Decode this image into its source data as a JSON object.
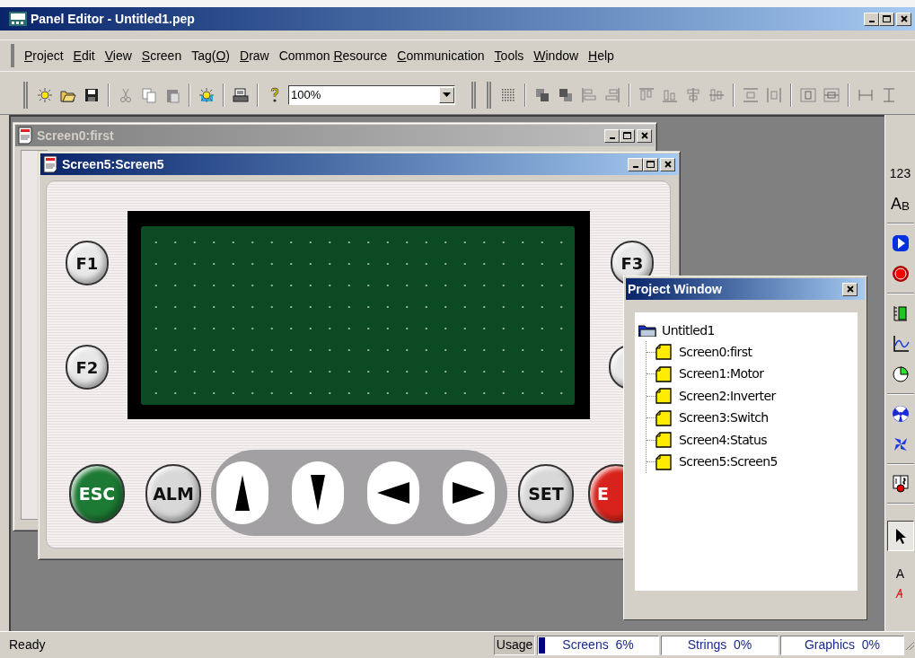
{
  "window": {
    "title": "Panel Editor - Untitled1.pep"
  },
  "menu": [
    {
      "key": "P",
      "post": "roject"
    },
    {
      "key": "E",
      "post": "dit"
    },
    {
      "key": "V",
      "post": "iew"
    },
    {
      "key": "S",
      "post": "creen"
    },
    {
      "pre": "Tag(",
      "key": "O",
      "post": ")"
    },
    {
      "key": "D",
      "post": "raw"
    },
    {
      "pre": "Common ",
      "key": "R",
      "post": "esource"
    },
    {
      "key": "C",
      "post": "ommunication"
    },
    {
      "key": "T",
      "post": "ools"
    },
    {
      "key": "W",
      "post": "indow"
    },
    {
      "key": "H",
      "post": "elp"
    }
  ],
  "toolbar": {
    "zoom": "100%"
  },
  "documents": [
    {
      "title": "Screen0:first",
      "active": false
    },
    {
      "title": "Screen5:Screen5",
      "active": true
    }
  ],
  "panel": {
    "side_keys": [
      {
        "label": "F1"
      },
      {
        "label": "F2"
      },
      {
        "label": "F3"
      }
    ],
    "bottom_keys": [
      {
        "label": "ESC",
        "color": "#1d7a34"
      },
      {
        "label": "ALM",
        "color": "#d8d8d8"
      },
      {
        "label": "SET",
        "color": "#d8d8d8"
      },
      {
        "label": "E",
        "color": "#d8231c"
      }
    ]
  },
  "project_window": {
    "title": "Project Window",
    "tree": {
      "label": "Untitled1",
      "children": [
        {
          "label": "Screen0:first"
        },
        {
          "label": "Screen1:Motor"
        },
        {
          "label": "Screen2:Inverter"
        },
        {
          "label": "Screen3:Switch"
        },
        {
          "label": "Screen4:Status"
        },
        {
          "label": "Screen5:Screen5"
        }
      ]
    }
  },
  "tools": [
    {
      "kind": "text",
      "label": "123",
      "selected": false
    },
    {
      "kind": "text",
      "label": "A$_{B}$",
      "selected": false
    },
    {
      "kind": "icon",
      "selected": false
    },
    {
      "kind": "icon",
      "selected": false
    },
    {
      "kind": "icon",
      "selected": false
    },
    {
      "kind": "icon",
      "selected": false
    },
    {
      "kind": "icon",
      "selected": false
    },
    {
      "kind": "icon",
      "selected": false
    },
    {
      "kind": "icon",
      "selected": false
    },
    {
      "kind": "icon",
      "selected": false
    },
    {
      "kind": "icon",
      "selected": true
    },
    {
      "kind": "text",
      "label": "A",
      "selected": false
    }
  ],
  "status_bar": {
    "message": "Ready",
    "usage": {
      "label": "Usage",
      "level": 0.05
    },
    "panes": [
      "Screens  6%",
      "Strings  0%",
      "Graphics  0%"
    ]
  }
}
